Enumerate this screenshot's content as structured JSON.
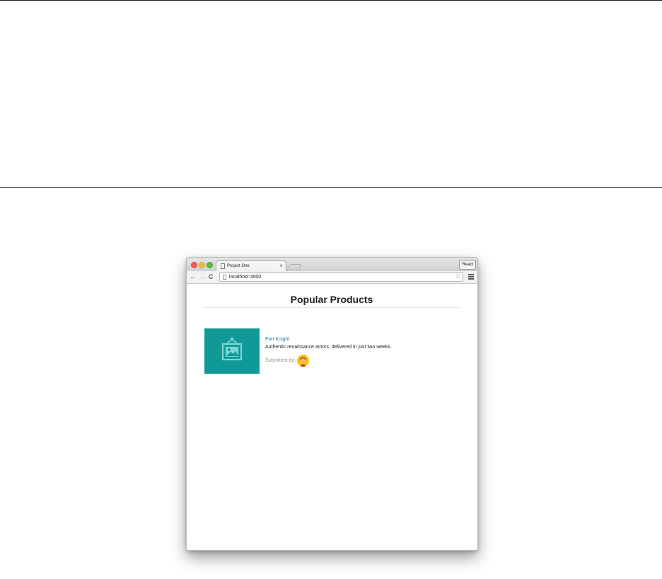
{
  "browser": {
    "tab": {
      "title": "Project One",
      "close_glyph": "×"
    },
    "profile_button": "React",
    "address": {
      "url": "localhost:3000"
    },
    "icons": {
      "back": "arrow-left-icon",
      "forward": "arrow-right-icon",
      "reload": "reload-icon",
      "bookmark": "star-icon",
      "menu": "hamburger-menu-icon",
      "page": "document-icon"
    }
  },
  "page": {
    "heading": "Popular Products",
    "products": [
      {
        "title": "Fort Knight",
        "description": "Authentic renaissance actors, delivered in just two weeks.",
        "submitted_label": "Submitted by:",
        "image_icon": "image-placeholder-icon",
        "avatar_icon": "user-avatar-icon"
      }
    ]
  },
  "colors": {
    "thumbnail_bg": "#0f9a98",
    "link": "#2b6fb6",
    "avatar_bg": "#f5c518"
  }
}
